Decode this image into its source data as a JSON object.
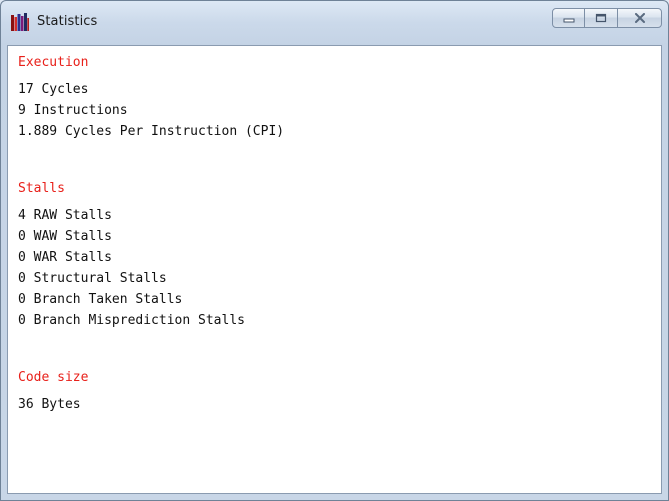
{
  "window": {
    "title": "Statistics",
    "app_icon": "books-icon",
    "buttons": {
      "minimize": "minimize-icon",
      "maximize": "maximize-icon",
      "close": "close-icon"
    }
  },
  "colors": {
    "section_title": "#e8201a",
    "text": "#111111",
    "client_background": "#ffffff"
  },
  "sections": {
    "execution": {
      "title": "Execution",
      "lines": [
        "17 Cycles",
        "9 Instructions",
        "1.889 Cycles Per Instruction (CPI)"
      ]
    },
    "stalls": {
      "title": "Stalls",
      "lines": [
        "4 RAW Stalls",
        "0 WAW Stalls",
        "0 WAR Stalls",
        "0 Structural Stalls",
        "0 Branch Taken Stalls",
        "0 Branch Misprediction Stalls"
      ]
    },
    "code_size": {
      "title": "Code size",
      "lines": [
        "36 Bytes"
      ]
    }
  }
}
